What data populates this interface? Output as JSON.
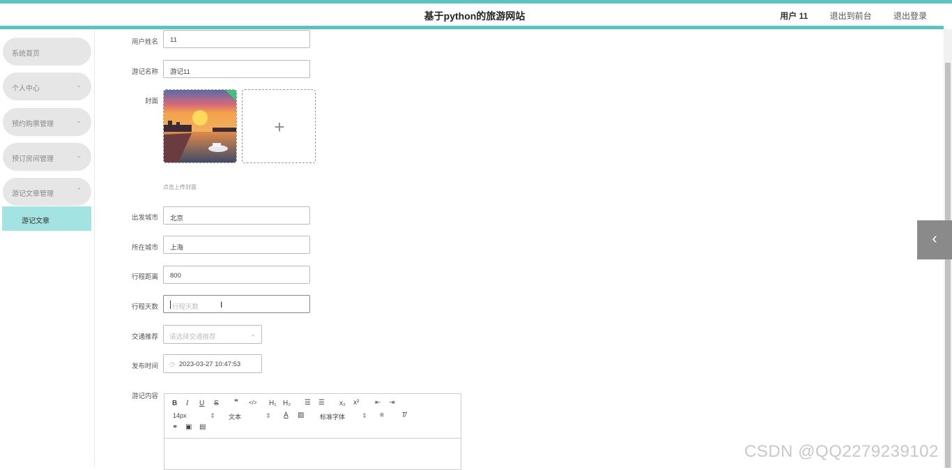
{
  "header": {
    "title": "基于python的旅游网站",
    "user": "用户 11",
    "back_front": "退出到前台",
    "logout": "退出登录"
  },
  "sidebar": {
    "items": [
      {
        "label": "系统首页"
      },
      {
        "label": "个人中心"
      },
      {
        "label": "预约购票管理"
      },
      {
        "label": "预订房间管理"
      },
      {
        "label": "游记文章管理"
      }
    ],
    "active_sub": "游记文章"
  },
  "form": {
    "username": {
      "label": "用户姓名",
      "value": "11"
    },
    "title": {
      "label": "游记名称",
      "value": "游记11"
    },
    "cover": {
      "label": "封面",
      "tip": "点击上传封面"
    },
    "depart": {
      "label": "出发城市",
      "value": "北京"
    },
    "located": {
      "label": "所在城市",
      "value": "上海"
    },
    "distance": {
      "label": "行程距离",
      "value": "800"
    },
    "days": {
      "label": "行程天数",
      "placeholder": "行程天数"
    },
    "transport": {
      "label": "交通推荐",
      "placeholder": "请选择交通推荐"
    },
    "publish_time": {
      "label": "发布时间",
      "value": "2023-03-27 10:47:53"
    },
    "content": {
      "label": "游记内容"
    }
  },
  "editor": {
    "font_size": "14px",
    "text_style": "文本",
    "font_family": "标准字体"
  },
  "watermark": "CSDN @QQ2279239102",
  "colors": {
    "accent": "#5bc4c0",
    "submenu_bg": "#a3e3e1"
  }
}
